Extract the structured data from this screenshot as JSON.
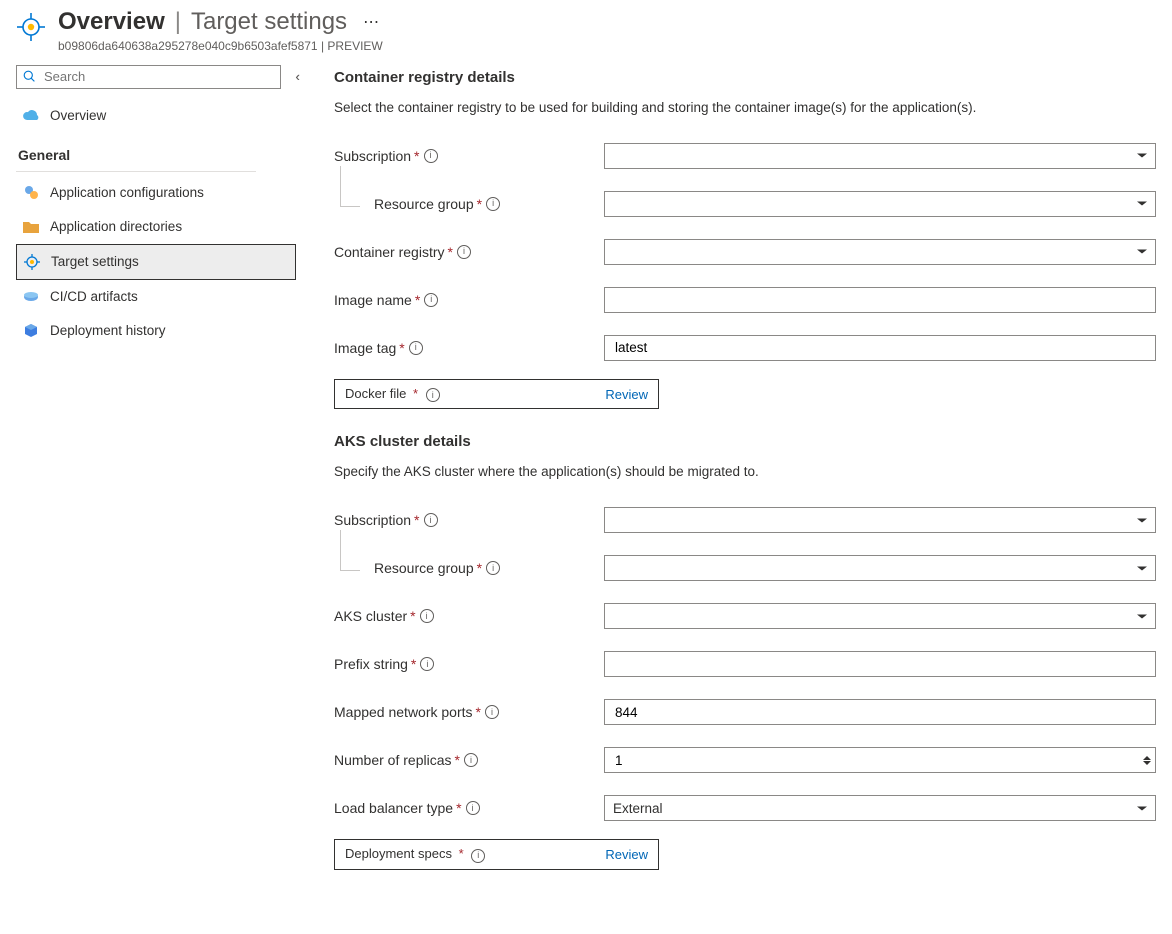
{
  "header": {
    "title_main": "Overview",
    "title_sub": "Target settings",
    "subhead_id": "b09806da640638a295278e040c9b6503afef5871",
    "subhead_badge": "PREVIEW"
  },
  "sidebar": {
    "search_placeholder": "Search",
    "overview_label": "Overview",
    "general_label": "General",
    "items": [
      {
        "label": "Application configurations"
      },
      {
        "label": "Application directories"
      },
      {
        "label": "Target settings"
      },
      {
        "label": "CI/CD artifacts"
      },
      {
        "label": "Deployment history"
      }
    ]
  },
  "sections": {
    "registry": {
      "heading": "Container registry details",
      "description": "Select the container registry to be used for building and storing the container image(s) for the application(s).",
      "labels": {
        "subscription": "Subscription",
        "resource_group": "Resource group",
        "container_registry": "Container registry",
        "image_name": "Image name",
        "image_tag": "Image tag",
        "docker_file": "Docker file"
      },
      "values": {
        "image_tag": "latest"
      },
      "review_link": "Review"
    },
    "aks": {
      "heading": "AKS cluster details",
      "description": "Specify the AKS cluster where the application(s) should be migrated to.",
      "labels": {
        "subscription": "Subscription",
        "resource_group": "Resource group",
        "aks_cluster": "AKS cluster",
        "prefix_string": "Prefix string",
        "mapped_ports": "Mapped network ports",
        "replicas": "Number of replicas",
        "lb_type": "Load balancer type",
        "deployment_specs": "Deployment specs"
      },
      "values": {
        "mapped_ports": "844",
        "replicas": "1",
        "lb_type": "External"
      },
      "review_link": "Review"
    }
  }
}
